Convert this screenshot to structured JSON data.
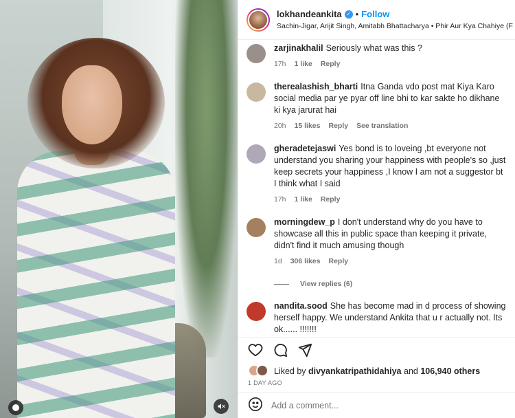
{
  "post": {
    "username": "lokhandeankita",
    "follow_label": "Follow",
    "audio": "Sachin-Jigar, Arijit Singh, Amitabh Bhattacharya • Phir Aur Kya Chahiye (F",
    "separator": "•"
  },
  "comments": [
    {
      "user": "zarjinakhalil",
      "text": "Seriously what was this ?",
      "time": "17h",
      "likes": "1 like",
      "reply": "Reply",
      "translation": "",
      "avatar_color": "#9a8f8a"
    },
    {
      "user": "therealashish_bharti",
      "text": "Itna Ganda vdo post mat Kiya Karo social media par ye pyar off line bhi to kar sakte ho dikhane ki kya jarurat hai",
      "time": "20h",
      "likes": "15 likes",
      "reply": "Reply",
      "translation": "See translation",
      "avatar_color": "#c9b8a0"
    },
    {
      "user": "gheradetejaswi",
      "text": "Yes bond is to loveing ,bt everyone not understand you sharing your happiness with people's so ,just keep secrets your happiness ,I know I am not a suggestor bt I think what I said",
      "time": "17h",
      "likes": "1 like",
      "reply": "Reply",
      "translation": "",
      "avatar_color": "#b0a7b8"
    },
    {
      "user": "morningdew_p",
      "text": "I don't understand why do you have to showcase all this in public space than keeping it private, didn't find it much amusing though",
      "time": "1d",
      "likes": "306 likes",
      "reply": "Reply",
      "translation": "",
      "avatar_color": "#a48060"
    },
    {
      "user": "nandita.sood",
      "text": "She has become mad in d process of showing herself happy. We understand Ankita that u r actually not. Its ok...... !!!!!!!",
      "time": "",
      "likes": "",
      "reply": "",
      "translation": "",
      "avatar_color": "#c0392b"
    }
  ],
  "view_replies": "View replies (6)",
  "likes": {
    "prefix": "Liked by",
    "user": "divyankatripathidahiya",
    "and": "and",
    "count": "106,940 others"
  },
  "time_ago": "1 DAY AGO",
  "add_comment_placeholder": "Add a comment...",
  "icons": {
    "like": "heart-icon",
    "comment": "comment-icon",
    "share": "send-icon",
    "emoji": "smiley-icon",
    "mute": "speaker-muted-icon",
    "verified": "verified-badge-icon"
  },
  "colors": {
    "accent": "#0095f6",
    "text": "#262626",
    "muted": "#737373"
  }
}
